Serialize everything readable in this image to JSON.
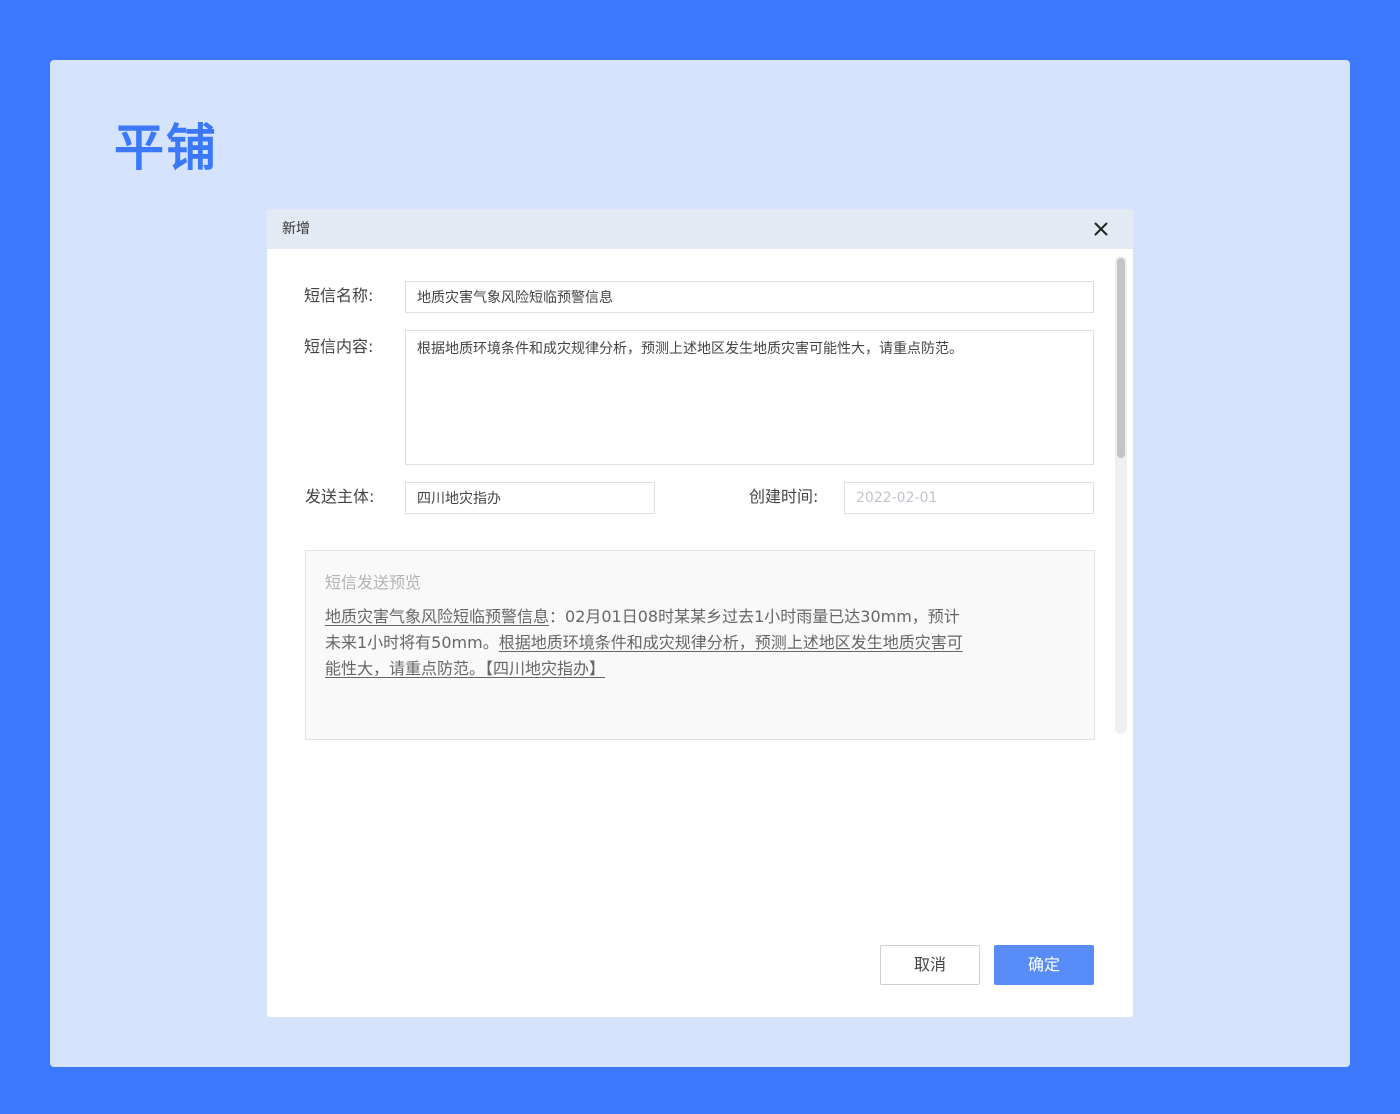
{
  "page": {
    "title": "平铺"
  },
  "dialog": {
    "title": "新增",
    "close_icon": "close-icon",
    "form": {
      "sms_name_label": "短信名称:",
      "sms_name_value": "地质灾害气象风险短临预警信息",
      "sms_content_label": "短信内容:",
      "sms_content_value": "根据地质环境条件和成灾规律分析，预测上述地区发生地质灾害可能性大，请重点防范。",
      "sender_label": "发送主体:",
      "sender_value": "四川地灾指办",
      "create_time_label": "创建时间:",
      "create_time_placeholder": "2022-02-01"
    },
    "preview": {
      "title": "短信发送预览",
      "name_part": "地质灾害气象风险短临预警信息",
      "info_part": "：02月01日08时某某乡过去1小时雨量已达30mm，预计未来1小时将有50mm。",
      "content_part": "根据地质环境条件和成灾规律分析，预测上述地区发生地质灾害可能性大，请重点防范。",
      "sender_part": "【四川地灾指办】"
    },
    "buttons": {
      "cancel_label": "取消",
      "ok_label": "确定"
    }
  },
  "colors": {
    "outer_background": "#3b78fc",
    "canvas_background": "#d6e3fc",
    "title_color": "#3b78fc",
    "header_background": "#e4eaf3",
    "primary_button": "#588cf9"
  }
}
